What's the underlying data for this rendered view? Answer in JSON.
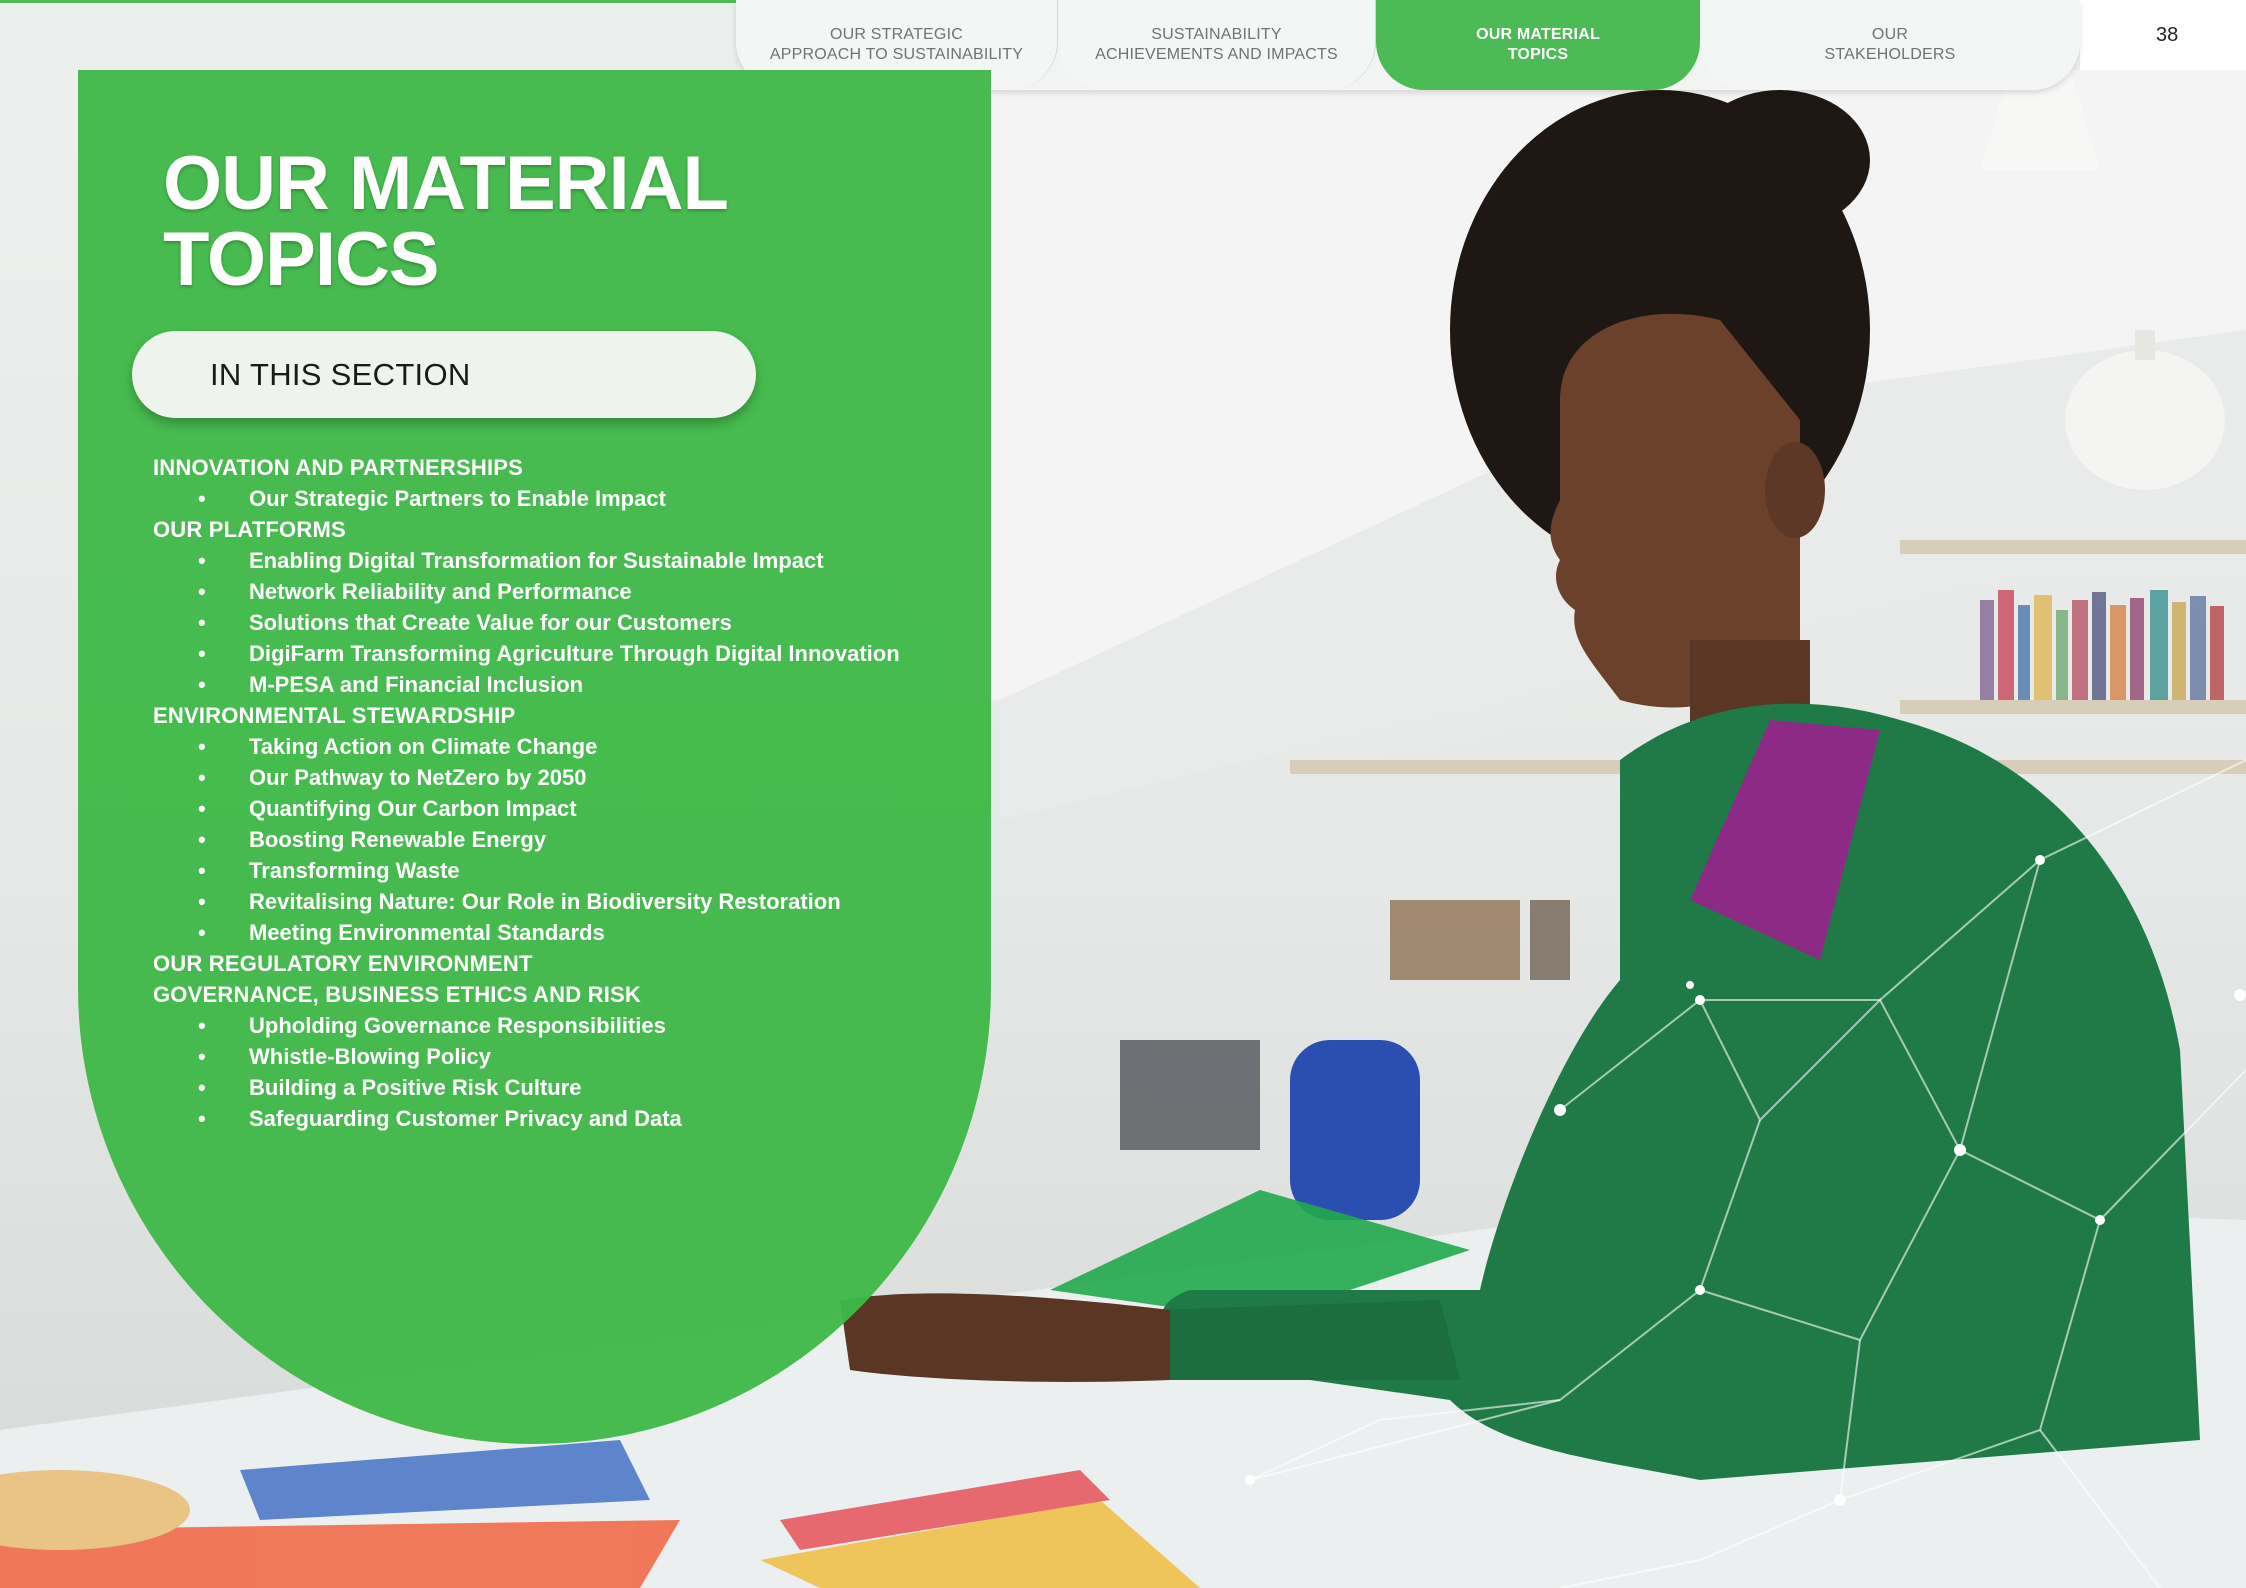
{
  "nav": {
    "tabs": [
      {
        "label": "OUR STRATEGIC\nAPPROACH TO SUSTAINABILITY",
        "active": false
      },
      {
        "label": "SUSTAINABILITY\nACHIEVEMENTS AND IMPACTS",
        "active": false
      },
      {
        "label": "OUR MATERIAL\nTOPICS",
        "active": true
      },
      {
        "label": "OUR\nSTAKEHOLDERS",
        "active": false
      }
    ],
    "page_number": "38"
  },
  "title": "OUR MATERIAL\nTOPICS",
  "section_label": "IN THIS SECTION",
  "toc": [
    {
      "heading": "INNOVATION AND PARTNERSHIPS",
      "items": [
        "Our Strategic Partners to Enable Impact"
      ]
    },
    {
      "heading": "OUR PLATFORMS",
      "items": [
        "Enabling Digital Transformation for Sustainable Impact",
        "Network Reliability and Performance",
        "Solutions that Create Value for our Customers",
        "DigiFarm Transforming Agriculture Through Digital Innovation",
        "M-PESA and Financial Inclusion"
      ]
    },
    {
      "heading": "ENVIRONMENTAL STEWARDSHIP",
      "items": [
        "Taking Action on Climate Change",
        "Our Pathway to NetZero by 2050",
        "Quantifying Our Carbon Impact",
        "Boosting Renewable Energy",
        "Transforming Waste",
        "Revitalising Nature: Our Role in Biodiversity Restoration",
        "Meeting Environmental Standards"
      ]
    },
    {
      "heading": "OUR REGULATORY ENVIRONMENT",
      "items": []
    },
    {
      "heading": "GOVERNANCE, BUSINESS ETHICS AND RISK",
      "items": [
        "Upholding Governance Responsibilities",
        "Whistle-Blowing Policy",
        "Building a Positive Risk Culture",
        "Safeguarding Customer Privacy and Data"
      ]
    }
  ],
  "colors": {
    "brand_green": "#4cbb55",
    "panel_green": "#40b848"
  }
}
